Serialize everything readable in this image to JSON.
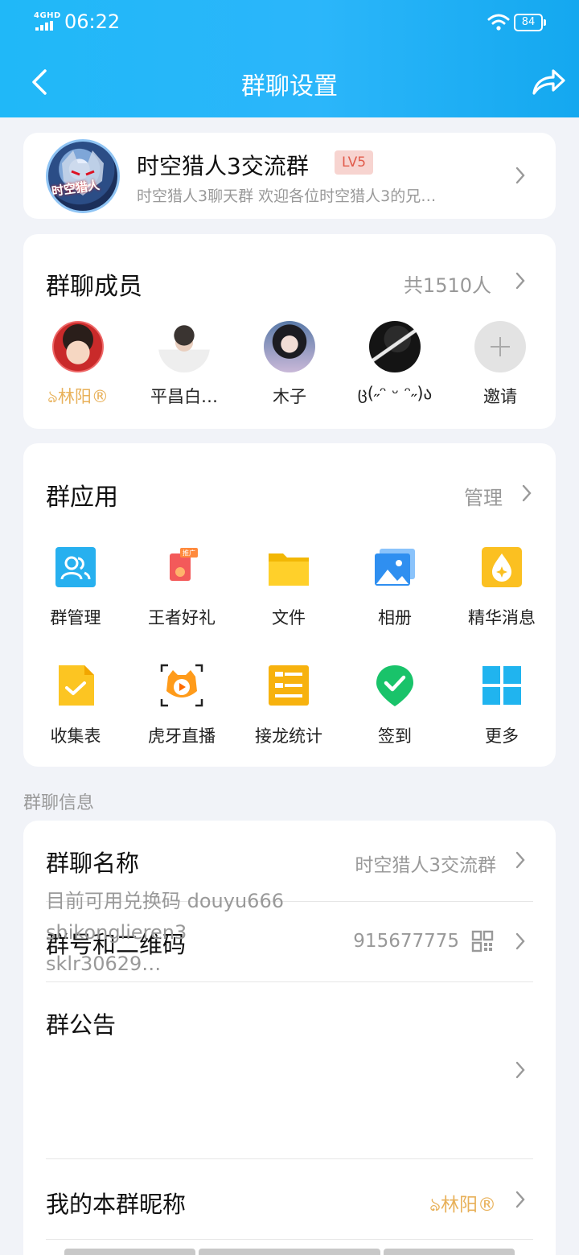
{
  "status": {
    "network": "4GHD",
    "time": "06:22",
    "battery": "84"
  },
  "header": {
    "title": "群聊设置"
  },
  "group": {
    "avatar_text": "时空猎人",
    "name": "时空猎人3交流群",
    "level": "LV5",
    "description": "时空猎人3聊天群 欢迎各位时空猎人3的兄…"
  },
  "members": {
    "title": "群聊成员",
    "count": "共1510人",
    "list": [
      {
        "name": "ঌ林阳®"
      },
      {
        "name": "平昌白…"
      },
      {
        "name": "木子"
      },
      {
        "name": "ც(˶ᵔ ᵕ ᵔ˶)ა"
      }
    ],
    "invite_label": "邀请"
  },
  "apps": {
    "title": "群应用",
    "manage": "管理",
    "badge": "推广",
    "items": [
      {
        "label": "群管理",
        "icon": "group-manage-icon"
      },
      {
        "label": "王者好礼",
        "icon": "gift-icon"
      },
      {
        "label": "文件",
        "icon": "folder-icon"
      },
      {
        "label": "相册",
        "icon": "album-icon"
      },
      {
        "label": "精华消息",
        "icon": "essence-icon"
      },
      {
        "label": "收集表",
        "icon": "form-icon"
      },
      {
        "label": "虎牙直播",
        "icon": "huya-icon"
      },
      {
        "label": "接龙统计",
        "icon": "relay-icon"
      },
      {
        "label": "签到",
        "icon": "checkin-icon"
      },
      {
        "label": "更多",
        "icon": "more-grid-icon"
      }
    ]
  },
  "info": {
    "section_label": "群聊信息",
    "name_label": "群聊名称",
    "name_value": "时空猎人3交流群",
    "number_label": "群号和二维码",
    "number_value": "915677775",
    "notice_label": "群公告",
    "notice_lines": [
      "目前可用兑换码 douyu666",
      "shikonglieren3",
      "sklr30629…"
    ],
    "nickname_label": "我的本群昵称",
    "nickname_value": "ঌ林阳®"
  },
  "colors": {
    "header": "#20b8f8",
    "level_bg": "#f7d4d0",
    "level_text": "#e15b4b",
    "nickname": "#e8b15a"
  }
}
